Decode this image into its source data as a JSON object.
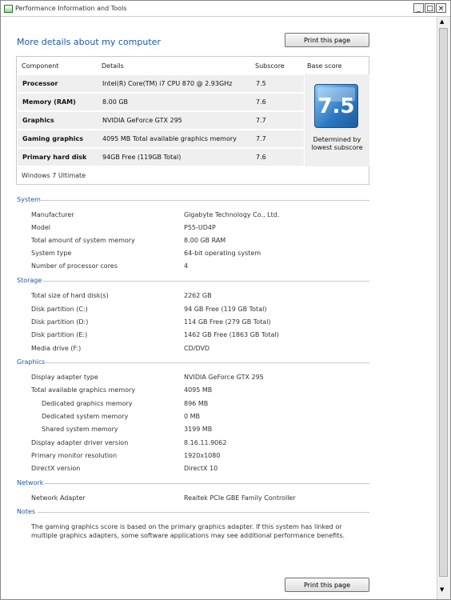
{
  "window": {
    "title": "Performance Information and Tools",
    "minimize": "_",
    "maximize": "□",
    "close": "×"
  },
  "heading": "More details about my computer",
  "print_label": "Print this page",
  "table": {
    "headers": {
      "component": "Component",
      "details": "Details",
      "subscore": "Subscore",
      "base": "Base score"
    },
    "rows": [
      {
        "component": "Processor",
        "details": "Intel(R) Core(TM) i7 CPU 870 @ 2.93GHz",
        "subscore": "7.5"
      },
      {
        "component": "Memory (RAM)",
        "details": "8.00 GB",
        "subscore": "7.6"
      },
      {
        "component": "Graphics",
        "details": "NVIDIA GeForce GTX 295",
        "subscore": "7.7"
      },
      {
        "component": "Gaming graphics",
        "details": "4095 MB Total available graphics memory",
        "subscore": "7.7"
      },
      {
        "component": "Primary hard disk",
        "details": "94GB Free (119GB Total)",
        "subscore": "7.6"
      }
    ],
    "base_score": "7.5",
    "base_caption_1": "Determined by",
    "base_caption_2": "lowest subscore",
    "edition": "Windows 7 Ultimate"
  },
  "sections": {
    "system": {
      "title": "System",
      "items": [
        {
          "label": "Manufacturer",
          "value": "Gigabyte Technology Co., Ltd."
        },
        {
          "label": "Model",
          "value": "P55-UD4P"
        },
        {
          "label": "Total amount of system memory",
          "value": "8.00 GB RAM"
        },
        {
          "label": "System type",
          "value": "64-bit operating system"
        },
        {
          "label": "Number of processor cores",
          "value": "4"
        }
      ]
    },
    "storage": {
      "title": "Storage",
      "items": [
        {
          "label": "Total size of hard disk(s)",
          "value": "2262 GB"
        },
        {
          "label": "Disk partition (C:)",
          "value": "94 GB Free (119 GB Total)"
        },
        {
          "label": "Disk partition (D:)",
          "value": "114 GB Free (279 GB Total)"
        },
        {
          "label": "Disk partition (E:)",
          "value": "1462 GB Free (1863 GB Total)"
        },
        {
          "label": "Media drive (F:)",
          "value": "CD/DVD"
        }
      ]
    },
    "graphics": {
      "title": "Graphics",
      "items": [
        {
          "label": "Display adapter type",
          "value": "NVIDIA GeForce GTX 295"
        },
        {
          "label": "Total available graphics memory",
          "value": "4095 MB"
        },
        {
          "label": "Dedicated graphics memory",
          "value": "896 MB"
        },
        {
          "label": "Dedicated system memory",
          "value": "0 MB"
        },
        {
          "label": "Shared system memory",
          "value": "3199 MB"
        },
        {
          "label": "Display adapter driver version",
          "value": "8.16.11.9062"
        },
        {
          "label": "Primary monitor resolution",
          "value": "1920x1080"
        },
        {
          "label": "DirectX version",
          "value": "DirectX 10"
        }
      ]
    },
    "network": {
      "title": "Network",
      "items": [
        {
          "label": "Network Adapter",
          "value": "Realtek PCIe GBE Family Controller"
        }
      ]
    },
    "notes": {
      "title": "Notes",
      "text": "The gaming graphics score is based on the primary graphics adapter. If this system has linked or multiple graphics adapters, some software applications may see additional performance benefits."
    }
  }
}
